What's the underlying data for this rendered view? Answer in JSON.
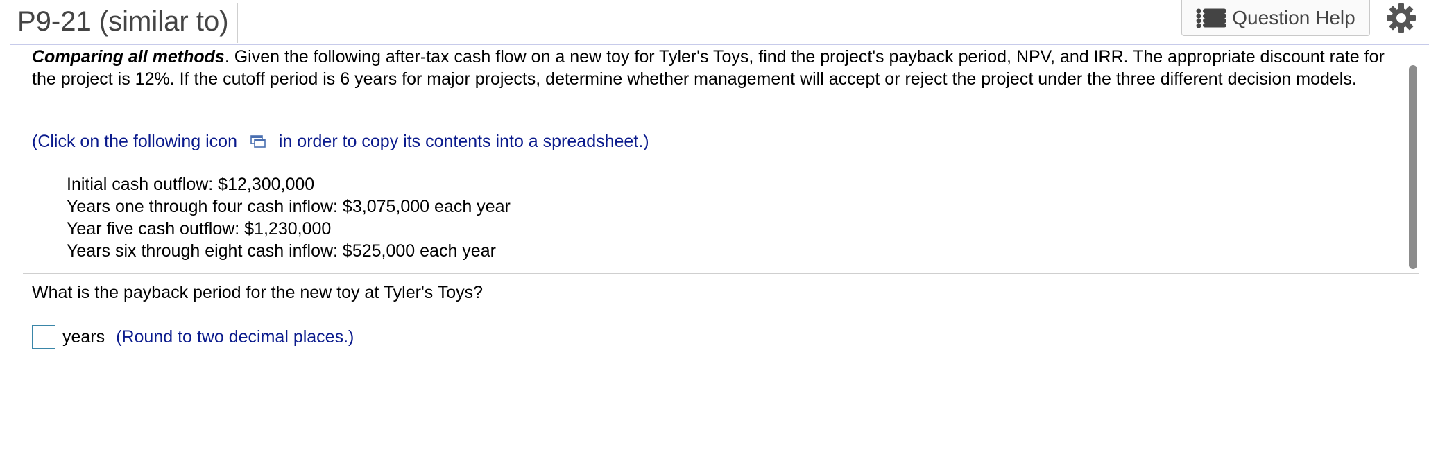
{
  "header": {
    "title": "P9-21 (similar to)",
    "question_help_label": "Question Help",
    "icons": [
      "list-icon",
      "gear-icon"
    ]
  },
  "problem": {
    "lead": "Comparing all methods",
    "text": ". Given the following after-tax cash flow on a new toy for Tyler's Toys, find the project's payback period, NPV, and IRR. The appropriate discount rate for the project is 12%. If the cutoff period is 6 years for major projects, determine whether management will accept or reject the project under the three different decision models.",
    "click_note_before": "(Click on the following icon",
    "click_note_after": "in order to copy its contents into a spreadsheet.)",
    "cash_flows": [
      "Initial cash outflow: $12,300,000",
      "Years one through four cash inflow: $3,075,000 each year",
      "Year five cash outflow: $1,230,000",
      "Years six through eight cash inflow: $525,000 each year"
    ]
  },
  "question": {
    "text": "What is the payback period for the new toy at Tyler's Toys?",
    "answer_value": "",
    "unit": "years",
    "hint": "(Round to two decimal places.)"
  },
  "colors": {
    "link_blue": "#0a1a8c",
    "header_line": "#c7cbea",
    "scrollbar": "#8c8c8c"
  }
}
